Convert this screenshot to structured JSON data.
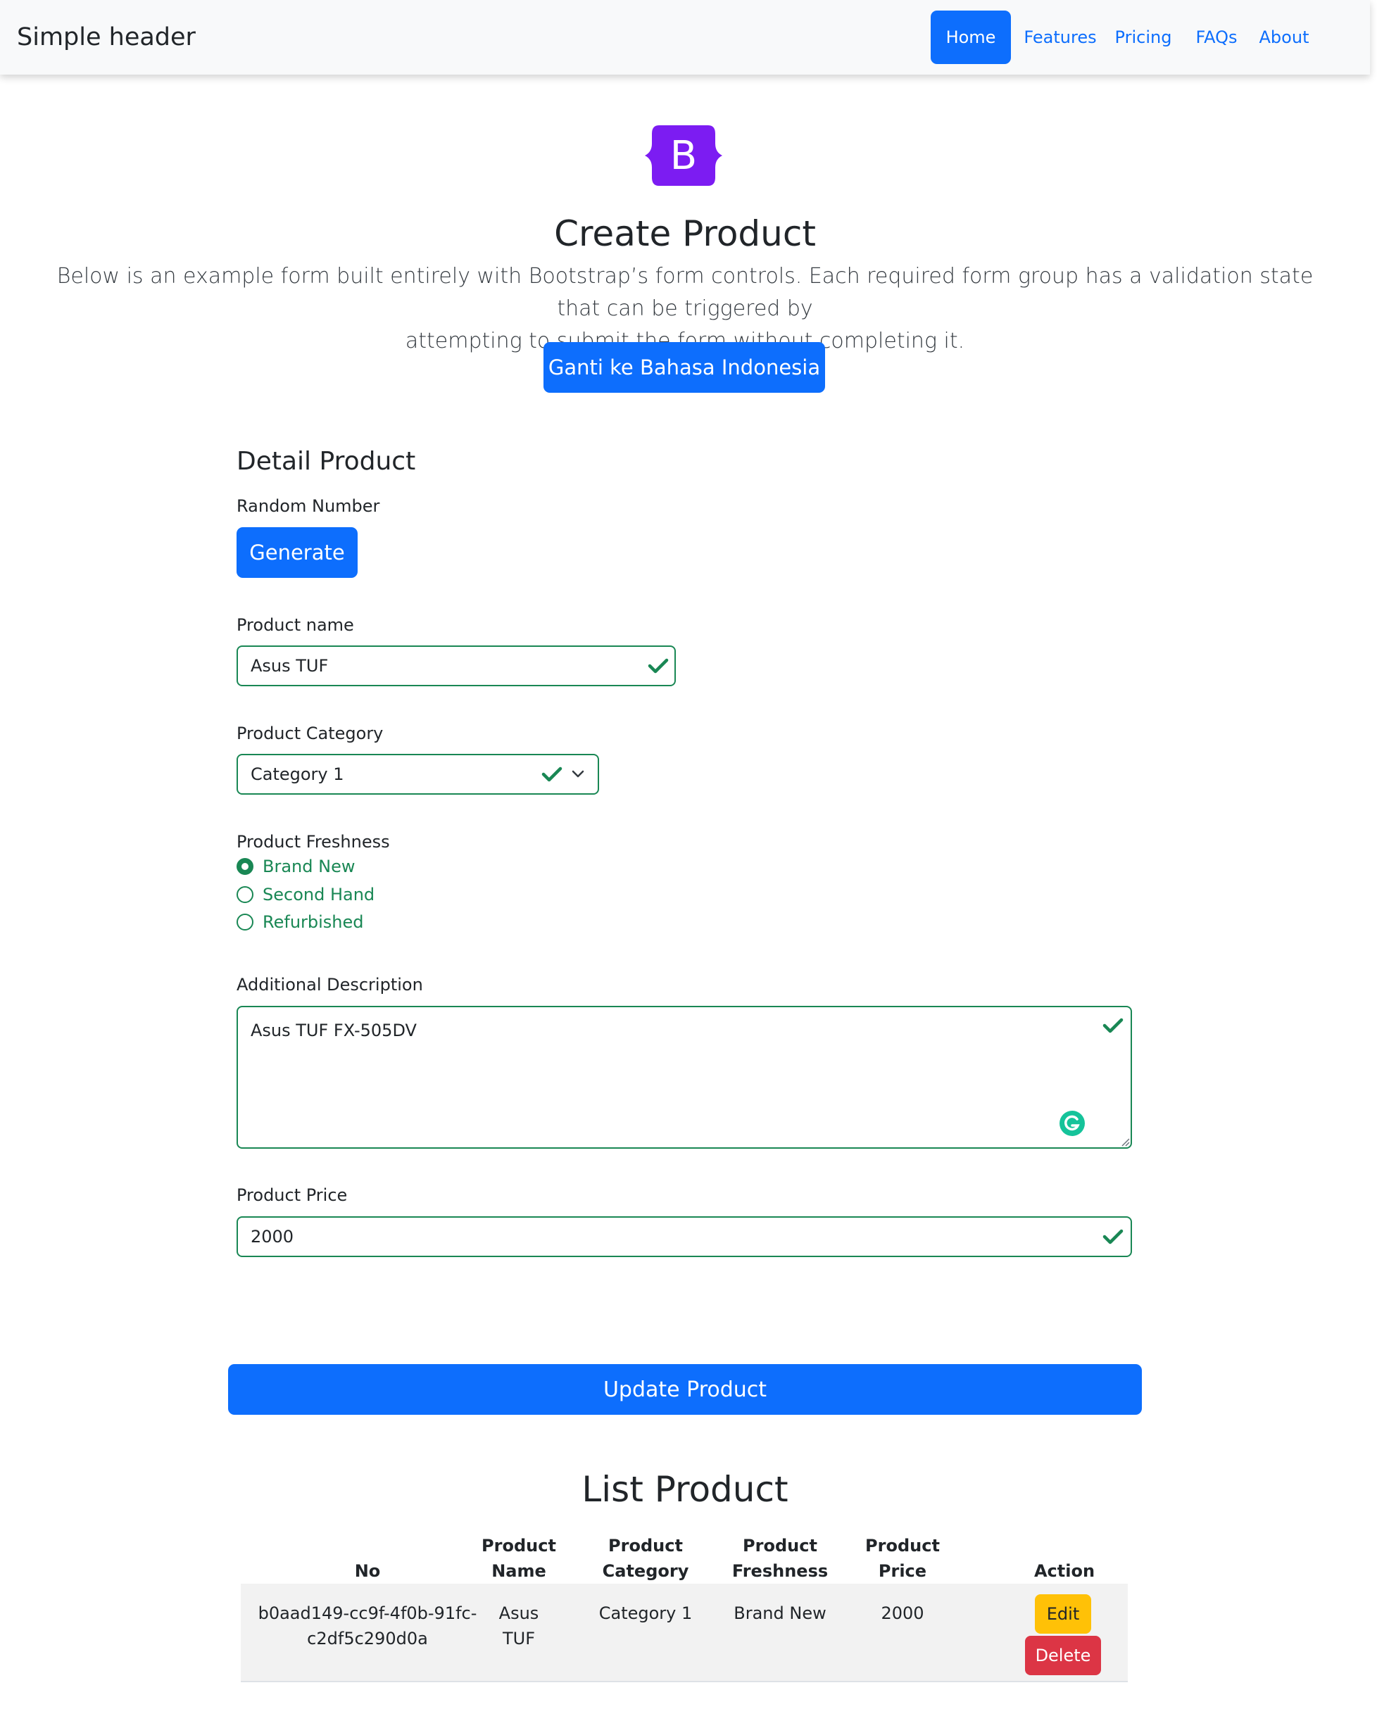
{
  "header": {
    "brand": "Simple header",
    "nav": [
      "Home",
      "Features",
      "Pricing",
      "FAQs",
      "About"
    ],
    "active": "Home"
  },
  "hero": {
    "logo_letter": "B",
    "title": "Create Product",
    "lead_line1": "Below is an example form built entirely with Bootstrap’s form controls. Each required form group has a validation state that can be triggered by",
    "lead_line2": "attempting to submit the form without completing it.",
    "language_button": "Ganti ke Bahasa Indonesia"
  },
  "form": {
    "section_title": "Detail Product",
    "random_label": "Random Number",
    "generate_button": "Generate",
    "name_label": "Product name",
    "name_value": "Asus TUF",
    "category_label": "Product Category",
    "category_value": "Category 1",
    "freshness_label": "Product Freshness",
    "freshness_options": [
      "Brand New",
      "Second Hand",
      "Refurbished"
    ],
    "freshness_selected": "Brand New",
    "description_label": "Additional Description",
    "description_value": "Asus TUF FX-505DV",
    "price_label": "Product Price",
    "price_value": "2000",
    "update_button": "Update Product"
  },
  "list": {
    "title": "List Product",
    "headers": {
      "no": "No",
      "name_1": "Product",
      "name_2": "Name",
      "category_1": "Product",
      "category_2": "Category",
      "freshness_1": "Product",
      "freshness_2": "Freshness",
      "price_1": "Product",
      "price_2": "Price",
      "action": "Action"
    },
    "rows": [
      {
        "no_line1": "b0aad149-cc9f-4f0b-91fc-",
        "no_line2": "c2df5c290d0a",
        "name": "Asus TUF",
        "category": "Category 1",
        "freshness": "Brand New",
        "price": "2000",
        "edit": "Edit",
        "delete": "Delete"
      }
    ]
  },
  "colors": {
    "primary": "#0d6efd",
    "valid": "#198754",
    "logo": "#7c1cf2",
    "warning": "#ffc107",
    "danger": "#dc3545",
    "grammarly": "#15c39a"
  }
}
